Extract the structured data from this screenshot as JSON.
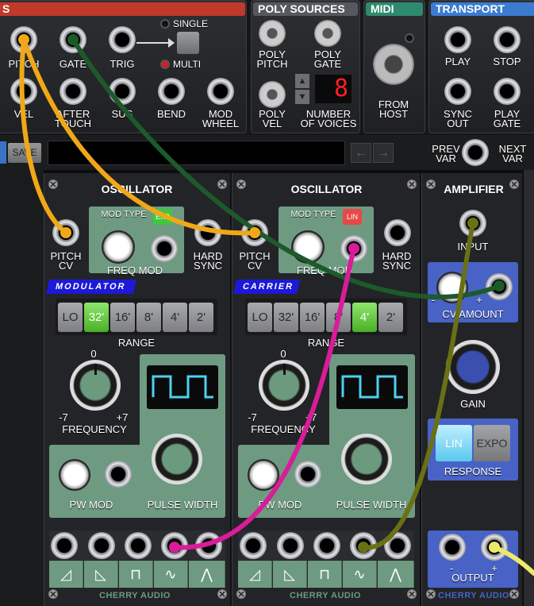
{
  "top": {
    "voice": {
      "jacks": {
        "pitch": "PITCH",
        "gate": "GATE",
        "trig": "TRIG",
        "vel": "VEL",
        "aftertouch": "AFTER TOUCH",
        "sus": "SUS",
        "bend": "BEND",
        "mod_wheel": "MOD WHEEL"
      },
      "single": "SINGLE",
      "multi": "MULTI"
    },
    "poly": {
      "title": "POLY SOURCES",
      "poly_pitch": "POLY PITCH",
      "poly_gate": "POLY GATE",
      "poly_vel": "POLY VEL",
      "number_of_voices": "NUMBER OF VOICES",
      "voices_value": "8"
    },
    "midi": {
      "title": "MIDI",
      "from_host": "FROM HOST"
    },
    "transport": {
      "title": "TRANSPORT",
      "play": "PLAY",
      "stop": "STOP",
      "sync_out": "SYNC OUT",
      "play_gate": "PLAY GATE"
    }
  },
  "toolbar": {
    "save": "SAVE",
    "prev_var": "PREV VAR",
    "next_var": "NEXT VAR",
    "back_arrow": "←",
    "forward_arrow": "→"
  },
  "modules": {
    "osc1": {
      "title": "OSCILLATOR",
      "badge": "MODULATOR",
      "mod_type": "MOD TYPE",
      "mod_type_mode": "EXP",
      "pitch_cv": "PITCH CV",
      "hard_sync": "HARD SYNC",
      "freq_mod": "FREQ MOD",
      "range_label": "RANGE",
      "ranges": [
        "LO",
        "32'",
        "16'",
        "8'",
        "4'",
        "2'"
      ],
      "range_selected": "32'",
      "frequency": "FREQUENCY",
      "freq_zero": "0",
      "freq_min": "-7",
      "freq_max": "+7",
      "pw_mod": "PW MOD",
      "pulse_width": "PULSE WIDTH",
      "brand": "CHERRY AUDIO",
      "minus": "-",
      "plus": "+"
    },
    "osc2": {
      "title": "OSCILLATOR",
      "badge": "CARRIER",
      "mod_type": "MOD TYPE",
      "mod_type_mode": "LIN",
      "pitch_cv": "PITCH CV",
      "hard_sync": "HARD SYNC",
      "freq_mod": "FREQ MOD",
      "range_label": "RANGE",
      "ranges": [
        "LO",
        "32'",
        "16'",
        "8'",
        "4'",
        "2'"
      ],
      "range_selected": "4'",
      "frequency": "FREQUENCY",
      "freq_zero": "0",
      "freq_min": "-7",
      "freq_max": "+7",
      "pw_mod": "PW MOD",
      "pulse_width": "PULSE WIDTH",
      "brand": "CHERRY AUDIO",
      "minus": "-",
      "plus": "+"
    },
    "amp": {
      "title": "AMPLIFIER",
      "input": "INPUT",
      "cv_amount": "CV AMOUNT",
      "gain": "GAIN",
      "lin": "LIN",
      "expo": "EXPO",
      "response": "RESPONSE",
      "response_selected": "LIN",
      "output": "OUTPUT",
      "minus": "-",
      "plus": "+",
      "brand": "CHERRY AUDIO"
    }
  },
  "wave_glyphs": [
    "◿",
    "◺",
    "⊓",
    "∿",
    "⋀"
  ],
  "colors": {
    "panel_green": "#6e9a82",
    "cable_orange": "#f0a818",
    "cable_green": "#1c5a2a",
    "cable_magenta": "#d81c9a",
    "cable_olive": "#6a7014",
    "cable_yellow": "#ecea6a",
    "amp_blue": "#4862c6"
  }
}
